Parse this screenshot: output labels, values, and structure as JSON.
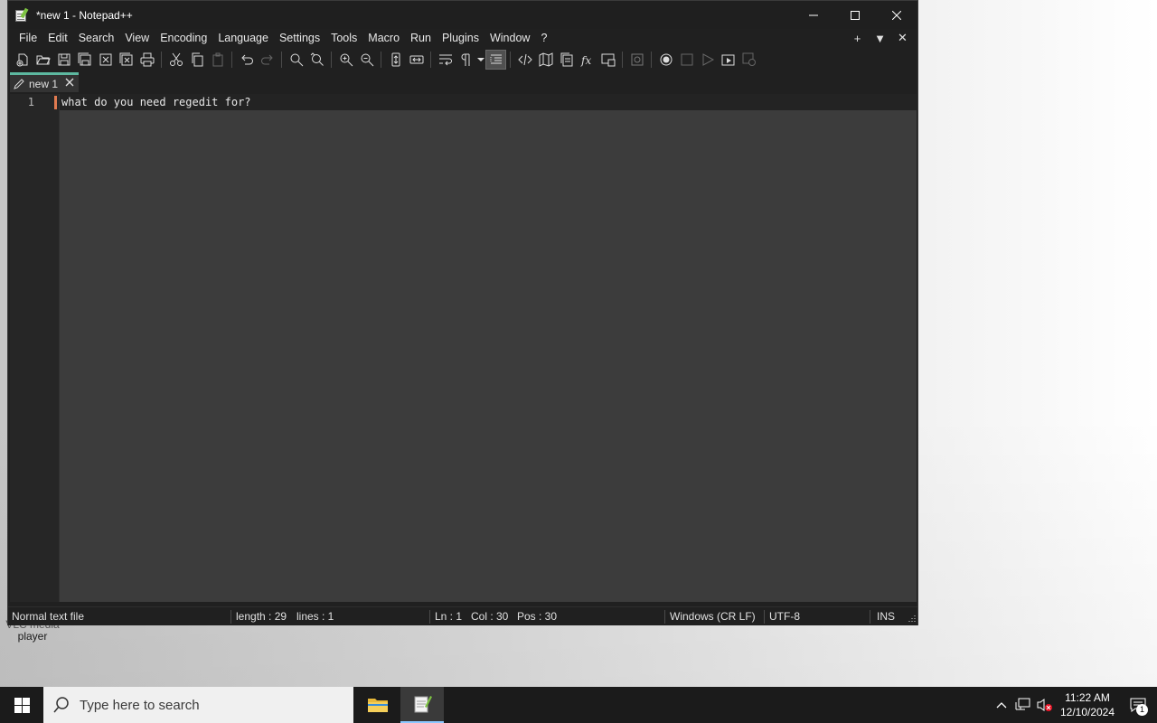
{
  "window": {
    "title": "*new 1 - Notepad++",
    "controls": [
      "minimize",
      "maximize",
      "close"
    ]
  },
  "menubar": {
    "items": [
      "File",
      "Edit",
      "Search",
      "View",
      "Encoding",
      "Language",
      "Settings",
      "Tools",
      "Macro",
      "Run",
      "Plugins",
      "Window",
      "?"
    ],
    "right": [
      "+",
      "▼",
      "✕"
    ]
  },
  "toolbar": {
    "icons": [
      "new-file-icon",
      "open-file-icon",
      "save-icon",
      "save-all-icon",
      "close-icon",
      "close-all-icon",
      "print-icon",
      "cut-icon",
      "copy-icon",
      "paste-icon",
      "undo-icon",
      "redo-icon",
      "find-icon",
      "replace-icon",
      "zoom-in-icon",
      "zoom-out-icon",
      "sync-vertical-icon",
      "sync-horizontal-icon",
      "word-wrap-icon",
      "show-all-chars-icon",
      "indent-guide-icon",
      "xml-tag-icon",
      "document-map-icon",
      "document-list-icon",
      "function-list-icon",
      "folder-workspace-icon",
      "monitoring-icon",
      "record-macro-icon",
      "stop-record-icon",
      "play-macro-icon",
      "run-macro-multiple-icon",
      "save-macro-icon"
    ]
  },
  "tabs": [
    {
      "label": "new 1",
      "active": true
    }
  ],
  "editor": {
    "lines": [
      {
        "number": "1",
        "text": "what do you need regedit for?"
      }
    ]
  },
  "statusbar": {
    "file_type": "Normal text file",
    "length": "length : 29",
    "lines": "lines : 1",
    "ln": "Ln : 1",
    "col": "Col : 30",
    "pos": "Pos : 30",
    "eol": "Windows (CR LF)",
    "encoding": "UTF-8",
    "mode": "INS"
  },
  "desktop": {
    "icon_label_partial": "VLC media",
    "icon_label": "player"
  },
  "taskbar": {
    "search_placeholder": "Type here to search",
    "time": "11:22 AM",
    "date": "12/10/2024",
    "notification_count": "1"
  },
  "colors": {
    "window_bg": "#202020",
    "editor_bg": "#3c3c3c",
    "tab_accent": "#5db8a0",
    "caret_marker": "#e07a50",
    "taskbar_bg": "#1b1b1b"
  }
}
